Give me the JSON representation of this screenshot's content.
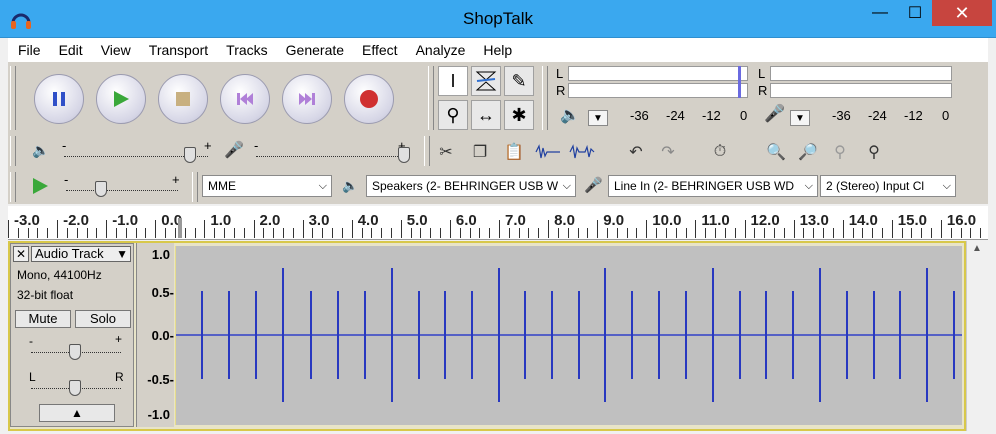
{
  "window": {
    "title": "ShopTalk",
    "minimize": "—",
    "maximize": "☐",
    "close": "✕"
  },
  "menu": [
    "File",
    "Edit",
    "View",
    "Transport",
    "Tracks",
    "Generate",
    "Effect",
    "Analyze",
    "Help"
  ],
  "meters": {
    "left_label": "L",
    "right_label": "R",
    "ticks": [
      "-36",
      "-24",
      "-12",
      "0"
    ]
  },
  "devices": {
    "host": "MME",
    "output": "Speakers (2- BEHRINGER USB W",
    "input": "Line In (2- BEHRINGER USB WD",
    "channels": "2 (Stereo) Input Cl"
  },
  "mixer": {
    "minus": "-",
    "plus": "+"
  },
  "play_speed": {
    "minus": "-",
    "plus": "+"
  },
  "ruler": [
    "-3.0",
    "-2.0",
    "-1.0",
    "0.0",
    "1.0",
    "2.0",
    "3.0",
    "4.0",
    "5.0",
    "6.0",
    "7.0",
    "8.0",
    "9.0",
    "10.0",
    "11.0",
    "12.0",
    "13.0",
    "14.0",
    "15.0",
    "16.0"
  ],
  "track": {
    "name": "Audio Track",
    "close": "✕",
    "info1": "Mono, 44100Hz",
    "info2": "32-bit float",
    "mute": "Mute",
    "solo": "Solo",
    "gain_minus": "-",
    "gain_plus": "+",
    "pan_left": "L",
    "pan_right": "R",
    "collapse": "▲"
  },
  "scale": [
    "1.0",
    "0.5-",
    "0.0-",
    "-0.5-",
    "-1.0"
  ]
}
